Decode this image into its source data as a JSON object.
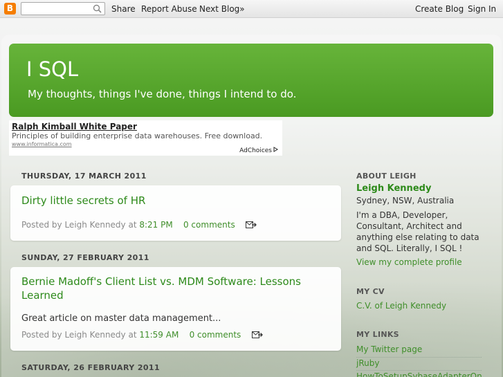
{
  "navbar": {
    "logo_letter": "B",
    "search_placeholder": "",
    "share": "Share",
    "report": "Report Abuse",
    "next": "Next Blog»",
    "create": "Create Blog",
    "signin": "Sign In"
  },
  "header": {
    "title": "I SQL",
    "description": "My thoughts, things I've done, things I intend to do."
  },
  "ad": {
    "title": "Ralph Kimball White Paper",
    "text": "Principles of building enterprise data warehouses. Free download.",
    "url": "www.informatica.com",
    "choices": "AdChoices"
  },
  "posts": [
    {
      "date": "THURSDAY, 17 MARCH 2011",
      "title": "Dirty little secrets of HR",
      "body": "",
      "footer_prefix": "Posted by Leigh Kennedy at",
      "time": "8:21 PM",
      "comments": "0 comments"
    },
    {
      "date": "SUNDAY, 27 FEBRUARY 2011",
      "title_line1": "Bernie Madoff's Client List vs. MDM Software: Lessons",
      "title_line2": "Learned",
      "body": "Great article on master data management...",
      "footer_prefix": "Posted by Leigh Kennedy at",
      "time": "11:59 AM",
      "comments": "0 comments"
    },
    {
      "date": "SATURDAY, 26 FEBRUARY 2011"
    }
  ],
  "sidebar": {
    "about_heading": "ABOUT LEIGH",
    "name": "Leigh Kennedy",
    "location": "Sydney, NSW, Australia",
    "bio_lines": [
      "I'm a DBA, Developer,",
      "Consultant, Architect and",
      "anything else relating to data",
      "and SQL. Literally, I SQL !"
    ],
    "profile_link": "View my complete profile",
    "cv_heading": "MY CV",
    "cv_link": "C.V. of Leigh Kennedy",
    "links_heading": "MY LINKS",
    "links": [
      "My Twitter page",
      "jRuby",
      "HowToSetupSybaseAdapterOn"
    ]
  },
  "colors": {
    "header_green": "#4a9a22",
    "link_green": "#3f8e2a",
    "title_green": "#2d8a1a"
  }
}
